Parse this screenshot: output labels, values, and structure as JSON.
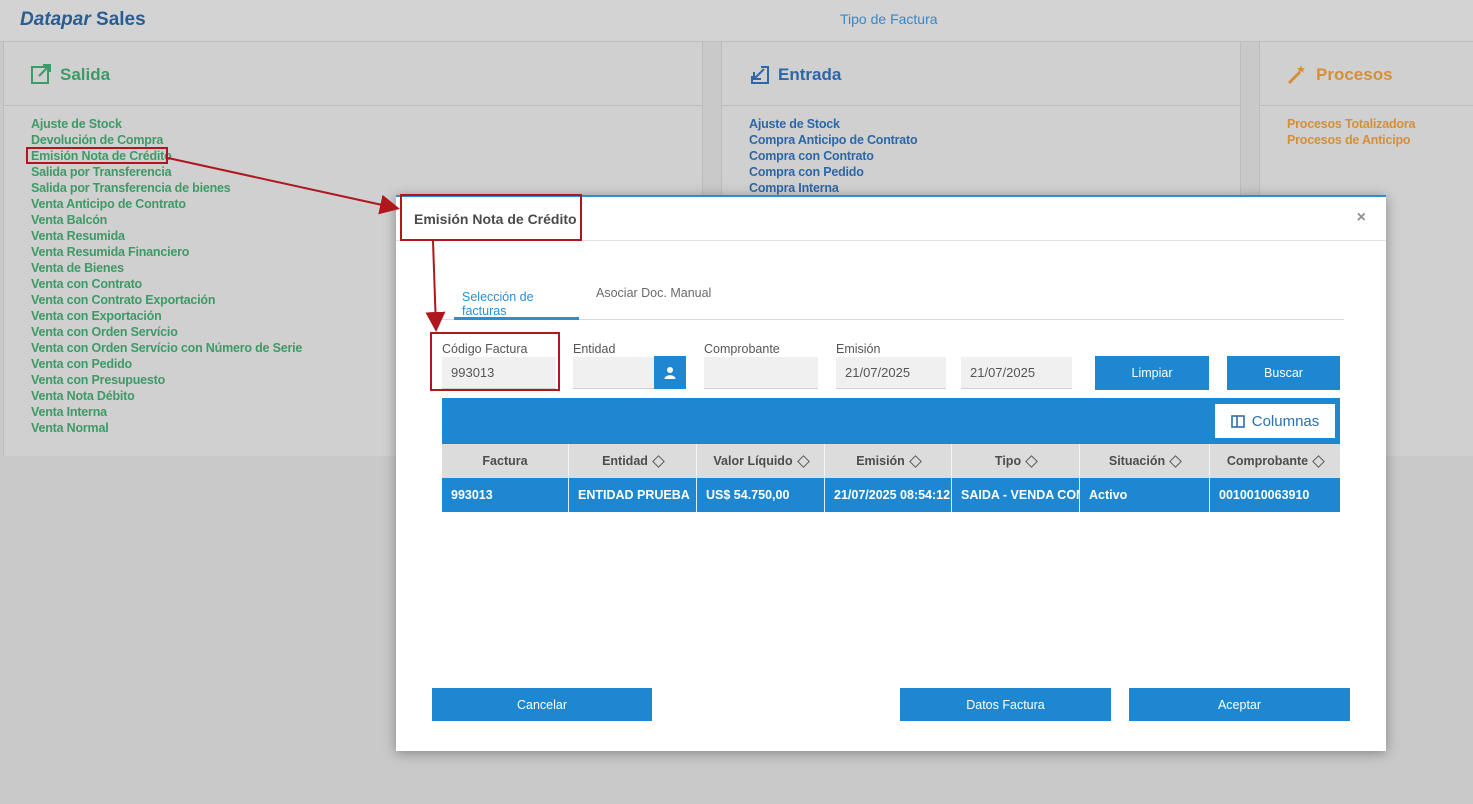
{
  "app": {
    "brand_italic": "Datapar",
    "brand_bold": "Sales"
  },
  "page": {
    "title": "Tipo de Factura"
  },
  "salida": {
    "title": "Salida",
    "items": [
      "Ajuste de Stock",
      "Devolución de Compra",
      "Emisión Nota de Crédito",
      "Salida por Transferencia",
      "Salida por Transferencia de bienes",
      "Venta Anticipo de Contrato",
      "Venta Balcón",
      "Venta Resumida",
      "Venta Resumida Financiero",
      "Venta de Bienes",
      "Venta con Contrato",
      "Venta con Contrato Exportación",
      "Venta con Exportación",
      "Venta con Orden Servício",
      "Venta con Orden Servício con Número de Serie",
      "Venta con Pedido",
      "Venta con Presupuesto",
      "Venta Nota Débito",
      "Venta Interna",
      "Venta Normal"
    ]
  },
  "entrada": {
    "title": "Entrada",
    "items": [
      "Ajuste de Stock",
      "Compra Anticipo de Contrato",
      "Compra con Contrato",
      "Compra con Pedido",
      "Compra Interna"
    ]
  },
  "procesos": {
    "title": "Procesos",
    "items": [
      "Procesos Totalizadora",
      "Procesos de Anticipo"
    ]
  },
  "modal": {
    "title": "Emisión Nota de Crédito",
    "close": "×",
    "tabs": [
      "Selección de facturas",
      "Asociar Doc. Manual"
    ],
    "filters": {
      "codigo_label": "Código Factura",
      "codigo_value": "993013",
      "entidad_label": "Entidad",
      "entidad_value": "",
      "comprobante_label": "Comprobante",
      "comprobante_value": "",
      "emision_label": "Emisión",
      "emision_from": "21/07/2025",
      "emision_to": "21/07/2025"
    },
    "buttons": {
      "limpiar": "Limpiar",
      "buscar": "Buscar",
      "columnas": "Columnas",
      "cancelar": "Cancelar",
      "datos": "Datos Factura",
      "aceptar": "Aceptar"
    },
    "table": {
      "headers": [
        "Factura",
        "Entidad",
        "Valor Líquido",
        "Emisión",
        "Tipo",
        "Situación",
        "Comprobante"
      ],
      "rows": [
        [
          "993013",
          "ENTIDAD PRUEBA",
          "US$ 54.750,00",
          "21/07/2025 08:54:12",
          "SAIDA - VENDA COM",
          "Activo",
          "0010010063910"
        ]
      ]
    }
  },
  "colors": {
    "accent": "#1d88d1",
    "highlight": "#b0171d",
    "salida": "#3e9a66",
    "entrada": "#2d67a8",
    "procesos": "#d48f3a"
  }
}
